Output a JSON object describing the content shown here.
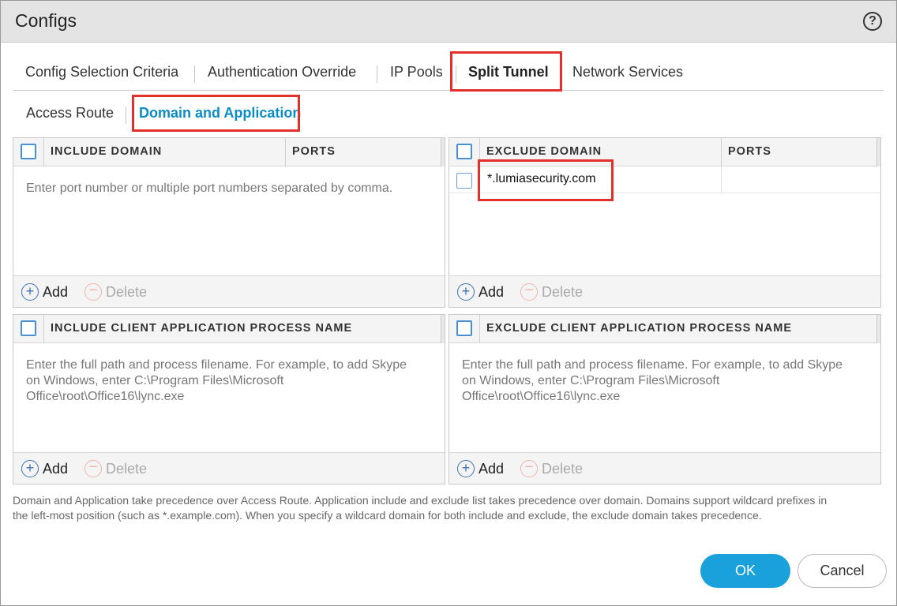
{
  "dialog": {
    "title": "Configs",
    "help_icon": "?"
  },
  "tabs": [
    {
      "label": "Config Selection Criteria"
    },
    {
      "label": "Authentication Override"
    },
    {
      "label": "IP Pools"
    },
    {
      "label": "Split Tunnel",
      "active": true
    },
    {
      "label": "Network Services"
    }
  ],
  "subtabs": [
    {
      "label": "Access Route"
    },
    {
      "label": "Domain and Application",
      "active": true
    }
  ],
  "include_domain": {
    "col1": "INCLUDE DOMAIN",
    "col2": "PORTS",
    "placeholder": "Enter port number or multiple port numbers separated by comma.",
    "add": "Add",
    "delete": "Delete"
  },
  "exclude_domain": {
    "col1": "EXCLUDE DOMAIN",
    "col2": "PORTS",
    "rows": [
      {
        "domain": "*.lumiasecurity.com",
        "ports": ""
      }
    ],
    "add": "Add",
    "delete": "Delete"
  },
  "include_app": {
    "col1": "INCLUDE CLIENT APPLICATION PROCESS NAME",
    "placeholder_lines": [
      "Enter the full path and process filename. For example, to add Skype",
      "on Windows, enter C:\\Program Files\\Microsoft",
      "Office\\root\\Office16\\lync.exe"
    ],
    "add": "Add",
    "delete": "Delete"
  },
  "exclude_app": {
    "col1": "EXCLUDE CLIENT APPLICATION PROCESS NAME",
    "placeholder_lines": [
      "Enter the full path and process filename. For example, to add Skype",
      "on Windows, enter C:\\Program Files\\Microsoft",
      "Office\\root\\Office16\\lync.exe"
    ],
    "add": "Add",
    "delete": "Delete"
  },
  "note": {
    "line1": "Domain and Application take precedence over Access Route. Application include and exclude list takes precedence over domain. Domains support wildcard prefixes in",
    "line2": "the left-most position (such as *.example.com). When you specify a wildcard domain for both include and exclude, the exclude domain takes precedence."
  },
  "buttons": {
    "ok": "OK",
    "cancel": "Cancel"
  },
  "colors": {
    "accent": "#1aa1dc",
    "highlight": "#e0312a",
    "active_subtab": "#0a8cc7"
  },
  "icons": {
    "add": "plus-circle-icon",
    "delete": "minus-circle-icon",
    "help": "help-circle-icon"
  }
}
